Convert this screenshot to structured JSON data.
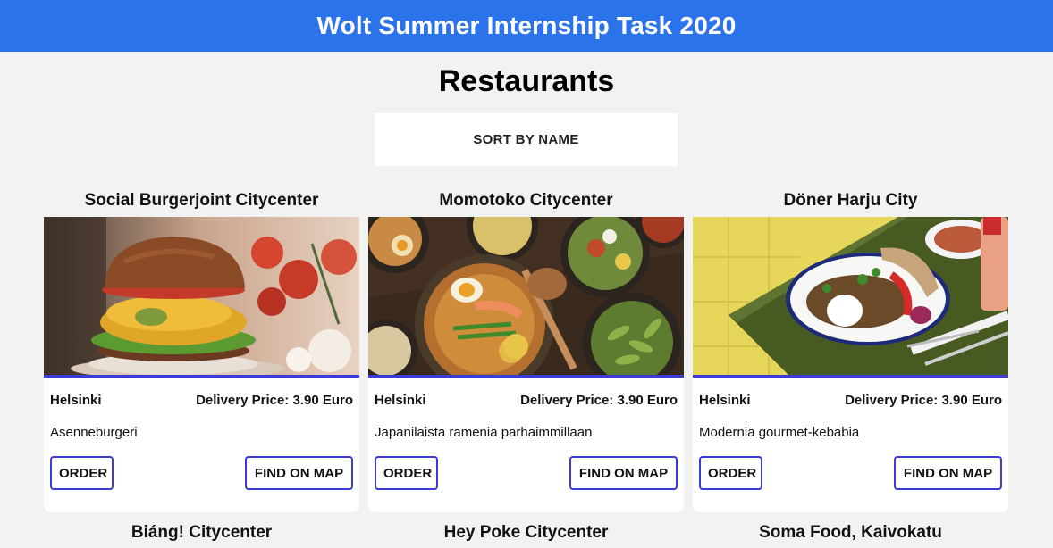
{
  "header": {
    "title": "Wolt Summer Internship Task 2020"
  },
  "page": {
    "title": "Restaurants"
  },
  "controls": {
    "sort_label": "SORT BY NAME"
  },
  "labels": {
    "order": "ORDER",
    "find_on_map": "FIND ON MAP"
  },
  "restaurants": [
    {
      "name": "Social Burgerjoint Citycenter",
      "city": "Helsinki",
      "delivery": "Delivery Price: 3.90 Euro",
      "description": "Asenneburgeri",
      "image": "burger"
    },
    {
      "name": "Momotoko Citycenter",
      "city": "Helsinki",
      "delivery": "Delivery Price: 3.90 Euro",
      "description": "Japanilaista ramenia parhaimmillaan",
      "image": "ramen"
    },
    {
      "name": "Döner Harju City",
      "city": "Helsinki",
      "delivery": "Delivery Price: 3.90 Euro",
      "description": "Modernia gourmet-kebabia",
      "image": "kebab"
    },
    {
      "name": "Biáng! Citycenter"
    },
    {
      "name": "Hey Poke Citycenter"
    },
    {
      "name": "Soma Food, Kaivokatu"
    }
  ],
  "colors": {
    "header_bg": "#2a73ea",
    "accent": "#3b3bd6",
    "page_bg": "#f2f2f2"
  }
}
